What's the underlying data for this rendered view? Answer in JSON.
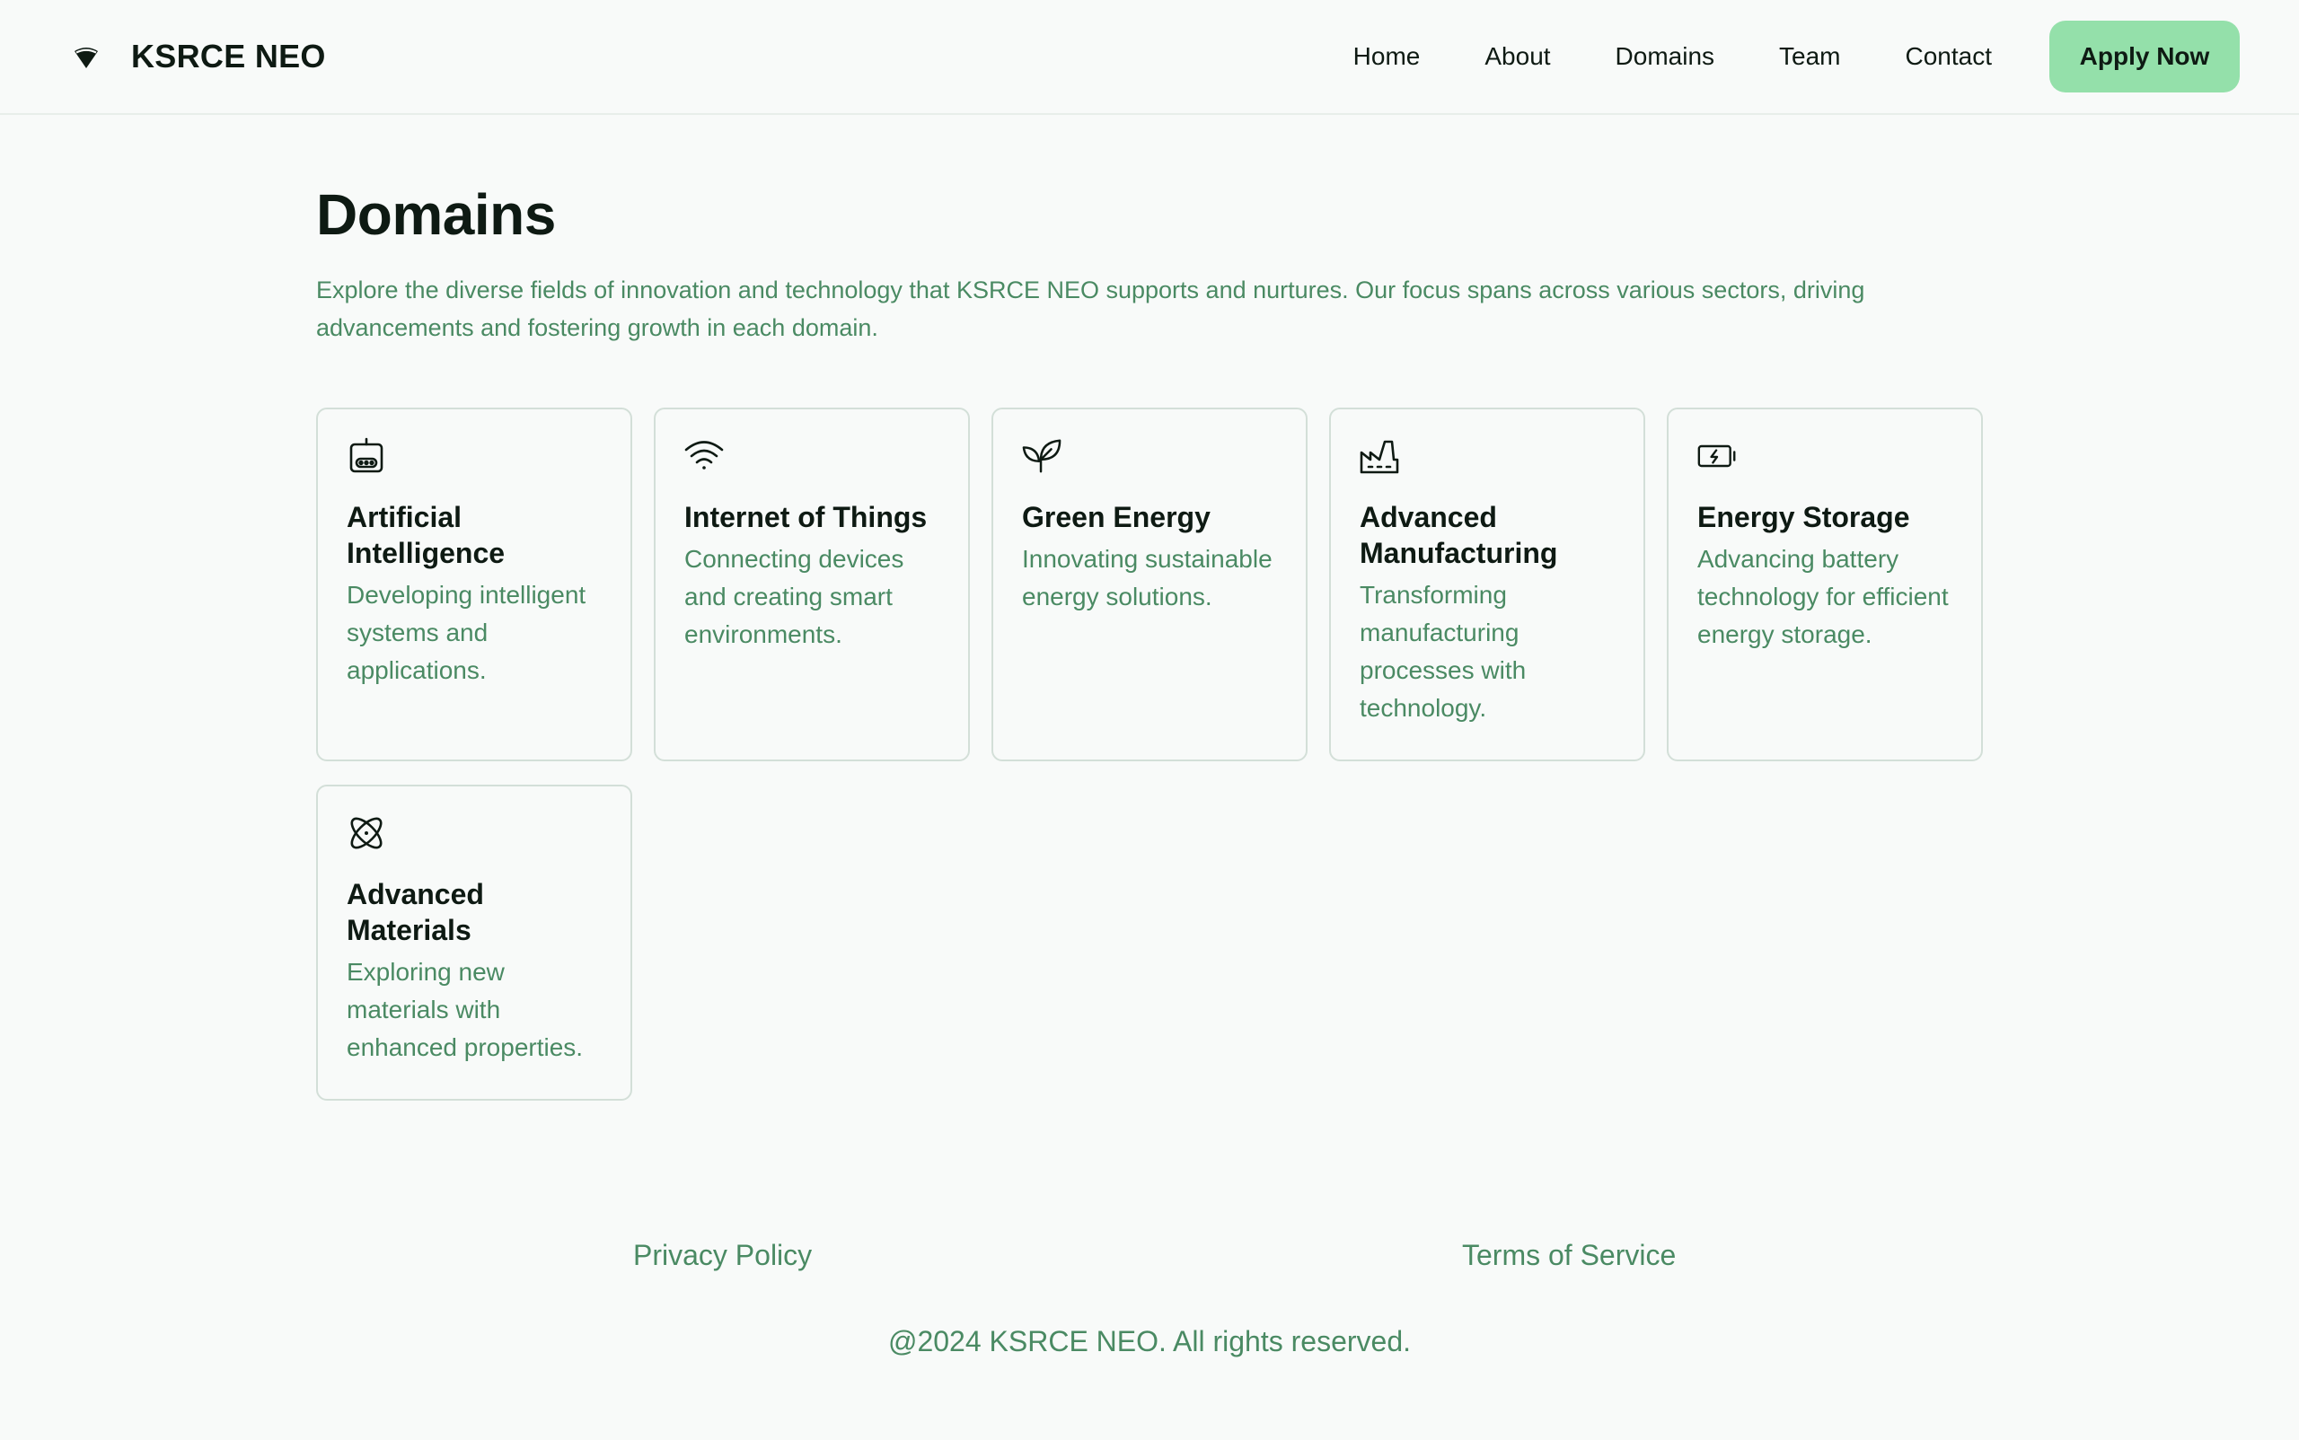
{
  "header": {
    "brand_name": "KSRCE NEO",
    "logo_icon": "shield-funnel-icon",
    "nav": [
      {
        "label": "Home"
      },
      {
        "label": "About"
      },
      {
        "label": "Domains"
      },
      {
        "label": "Team"
      },
      {
        "label": "Contact"
      }
    ],
    "cta_label": "Apply Now"
  },
  "main": {
    "title": "Domains",
    "description": "Explore the diverse fields of innovation and technology that KSRCE NEO supports and nurtures. Our focus spans across various sectors, driving advancements and fostering growth in each domain.",
    "domains": [
      {
        "title": "Artificial Intelligence",
        "description": "Developing intelligent systems and applications.",
        "icon": "robot-icon"
      },
      {
        "title": "Internet of Things",
        "description": "Connecting devices and creating smart environments.",
        "icon": "wifi-icon"
      },
      {
        "title": "Green Energy",
        "description": "Innovating sustainable energy solutions.",
        "icon": "plant-icon"
      },
      {
        "title": "Advanced Manufacturing",
        "description": "Transforming manufacturing processes with technology.",
        "icon": "factory-icon"
      },
      {
        "title": "Energy Storage",
        "description": "Advancing battery technology for efficient energy storage.",
        "icon": "battery-charging-icon"
      },
      {
        "title": "Advanced Materials",
        "description": "Exploring new materials with enhanced properties.",
        "icon": "atom-icon"
      }
    ]
  },
  "footer": {
    "links": [
      {
        "label": "Privacy Policy"
      },
      {
        "label": "Terms of Service"
      }
    ],
    "copyright": "@2024 KSRCE NEO. All rights reserved."
  },
  "colors": {
    "background": "#f8faf9",
    "accent": "#94e0aa",
    "muted_text": "#4a8a63",
    "text": "#0e1a13",
    "card_border": "#d3dfd8"
  }
}
